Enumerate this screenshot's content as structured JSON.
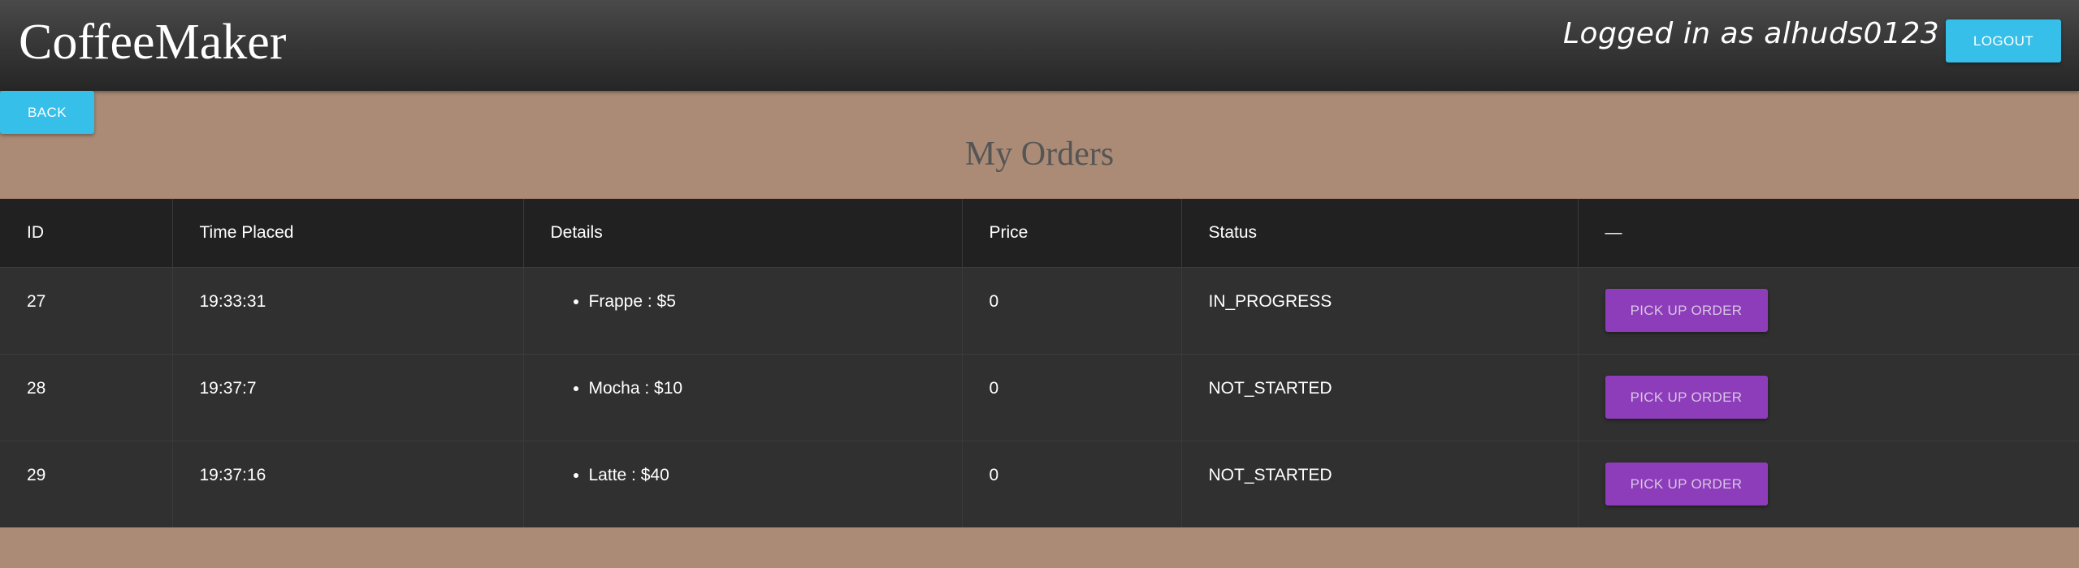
{
  "header": {
    "brand": "CoffeeMaker",
    "logged_in_text": "Logged in as alhuds0123",
    "logout_label": "LOGOUT"
  },
  "nav": {
    "back_label": "BACK"
  },
  "page": {
    "title": "My Orders"
  },
  "table": {
    "columns": [
      "ID",
      "Time Placed",
      "Details",
      "Price",
      "Status",
      "—"
    ],
    "rows": [
      {
        "id": "27",
        "time": "19:33:31",
        "details": [
          "Frappe : $5"
        ],
        "price": "0",
        "status": "IN_PROGRESS",
        "action": "PICK UP ORDER"
      },
      {
        "id": "28",
        "time": "19:37:7",
        "details": [
          "Mocha : $10"
        ],
        "price": "0",
        "status": "NOT_STARTED",
        "action": "PICK UP ORDER"
      },
      {
        "id": "29",
        "time": "19:37:16",
        "details": [
          "Latte : $40"
        ],
        "price": "0",
        "status": "NOT_STARTED",
        "action": "PICK UP ORDER"
      }
    ]
  },
  "colors": {
    "background": "#ab8b75",
    "header": "#2f2f2f",
    "accent_blue": "#35bfe9",
    "accent_purple": "#8e3dba",
    "table_header": "#212121",
    "table_row": "#303030"
  }
}
